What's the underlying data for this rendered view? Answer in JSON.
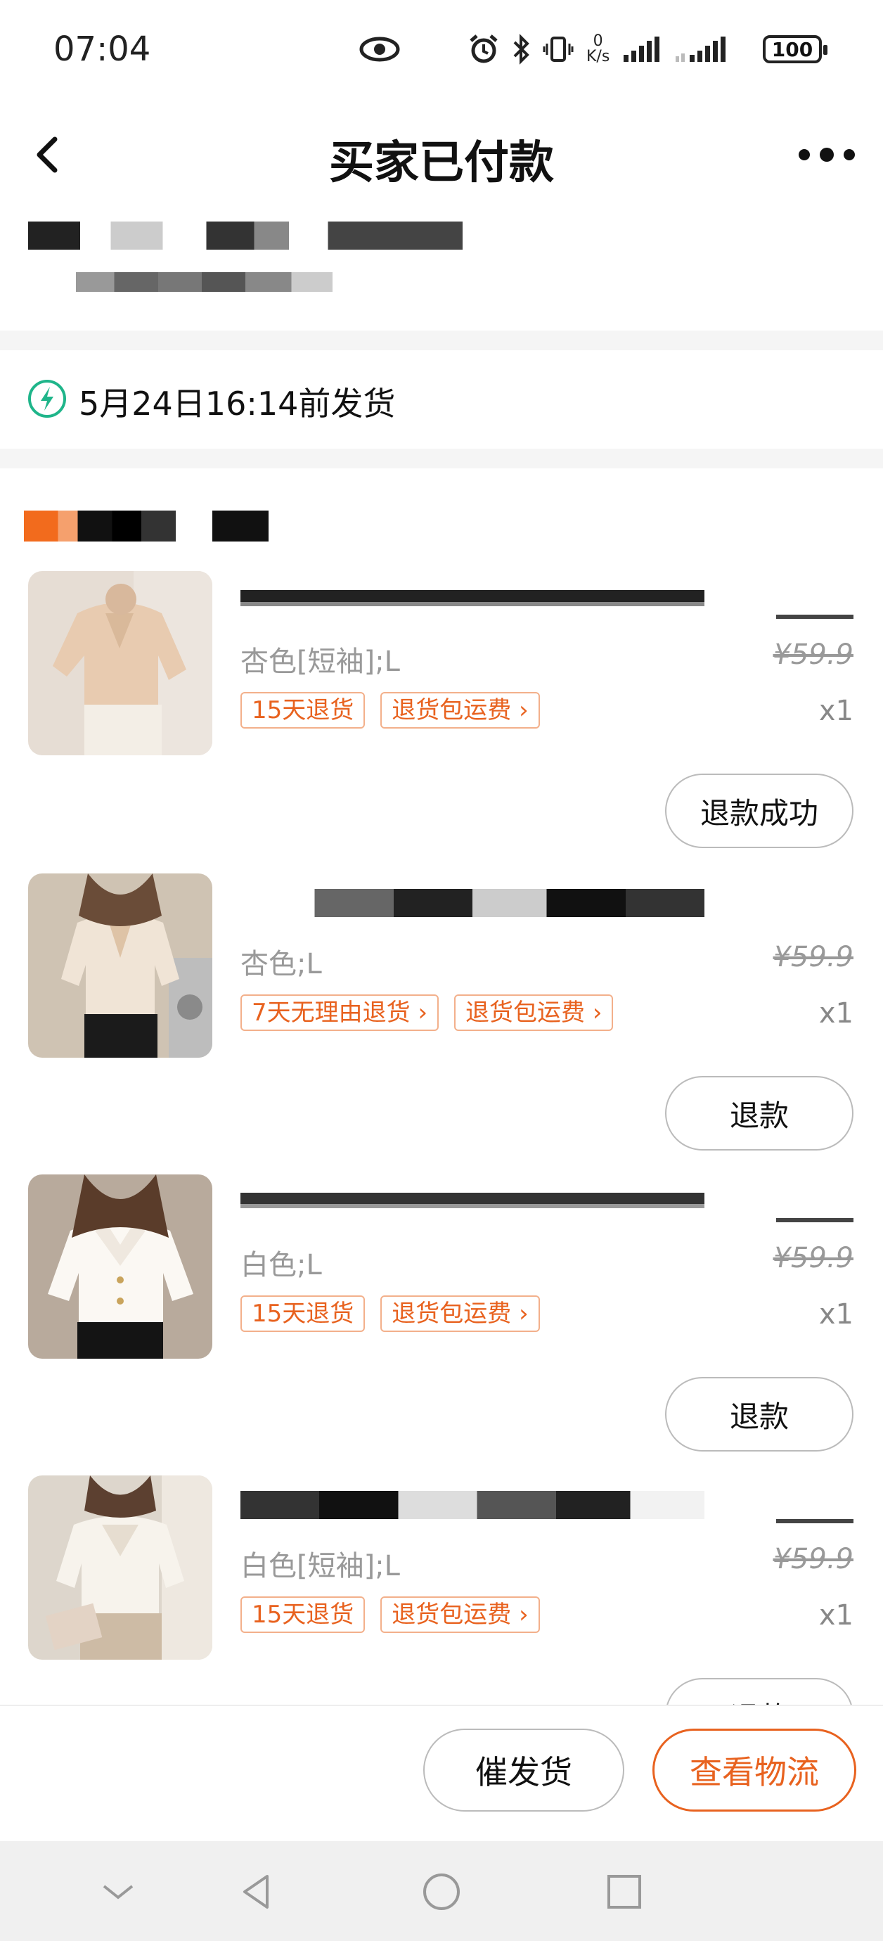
{
  "status_bar": {
    "time": "07:04",
    "net_speed_value": "0",
    "net_speed_unit": "K/s",
    "battery": "100",
    "icons": [
      "eye-icon",
      "alarm-icon",
      "bluetooth-icon",
      "vibrate-icon",
      "signal-icon",
      "signal-icon-2"
    ]
  },
  "header": {
    "title": "买家已付款"
  },
  "shipping": {
    "deadline_text": "5月24日16:14前发货",
    "icon": "lightning-icon",
    "icon_color": "#1fb58a"
  },
  "accent_color": "#e8621f",
  "items": [
    {
      "spec": "杏色[短袖];L",
      "price": "¥59.9",
      "qty": "x1",
      "tags": [
        "15天退货",
        "退货包运费 ›"
      ],
      "action": "退款成功"
    },
    {
      "spec": "杏色;L",
      "price": "¥59.9",
      "qty": "x1",
      "tags": [
        "7天无理由退货 ›",
        "退货包运费 ›"
      ],
      "action": "退款"
    },
    {
      "spec": "白色;L",
      "price": "¥59.9",
      "qty": "x1",
      "tags": [
        "15天退货",
        "退货包运费 ›"
      ],
      "action": "退款"
    },
    {
      "spec": "白色[短袖];L",
      "price": "¥59.9",
      "qty": "x1",
      "tags": [
        "15天退货",
        "退货包运费 ›"
      ],
      "action": "退款"
    }
  ],
  "bottom_bar": {
    "urge_label": "催发货",
    "track_label": "查看物流"
  }
}
